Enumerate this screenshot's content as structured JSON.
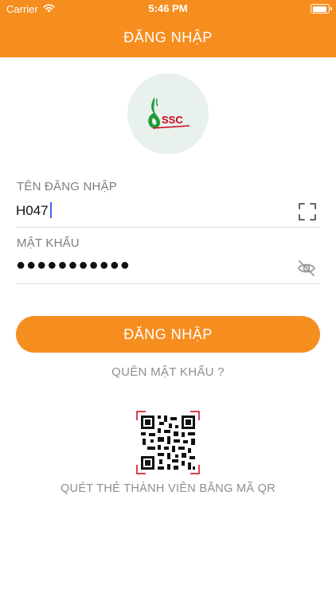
{
  "status_bar": {
    "carrier": "Carrier",
    "time": "5:46 PM"
  },
  "header": {
    "title": "ĐĂNG NHẬP"
  },
  "logo": {
    "text": "SSC",
    "color": "#1f9a3a"
  },
  "form": {
    "username": {
      "label": "TÊN ĐĂNG NHẬP",
      "value": "H047"
    },
    "password": {
      "label": "MẬT KHẨU",
      "value": "●●●●●●●●●●●"
    }
  },
  "actions": {
    "login_label": "ĐĂNG NHẬP",
    "forgot_label": "QUÊN MẬT KHẨU ?",
    "qr_caption": "QUÉT THẺ THÀNH VIÊN BẰNG MÃ QR"
  },
  "theme": {
    "accent": "#f68d1f",
    "qr_corner_color": "#d0021b"
  }
}
